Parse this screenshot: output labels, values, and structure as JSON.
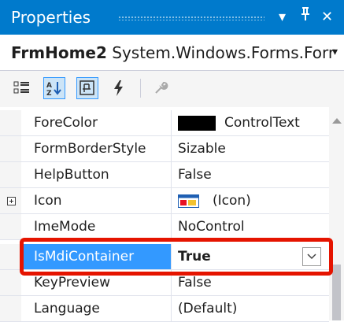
{
  "panel": {
    "title": "Properties",
    "pin_icon": "pin-icon",
    "close_icon": "close-icon",
    "dropdown_icon": "triangle-down-icon"
  },
  "object_selector": {
    "object_name": "FrmHome2",
    "object_type": "System.Windows.Forms.Forr",
    "arrow": "▾"
  },
  "toolbar": {
    "buttons": [
      "categorized-icon",
      "alphabetical-icon",
      "properties-icon",
      "events-icon",
      "property-pages-icon"
    ]
  },
  "properties": [
    {
      "name": "ForeColor",
      "value": "ControlText",
      "color": "#000000"
    },
    {
      "name": "FormBorderStyle",
      "value": "Sizable"
    },
    {
      "name": "HelpButton",
      "value": "False"
    },
    {
      "name": "Icon",
      "value": "(Icon)",
      "expandable": true
    },
    {
      "name": "ImeMode",
      "value": "NoControl"
    },
    {
      "name": "IsMdiContainer",
      "value": "True",
      "selected": true
    },
    {
      "name": "KeyPreview",
      "value": "False"
    },
    {
      "name": "Language",
      "value": "(Default)"
    }
  ],
  "colors": {
    "accent": "#007acc",
    "selection": "#3399ff",
    "highlight_border": "#e51400"
  }
}
